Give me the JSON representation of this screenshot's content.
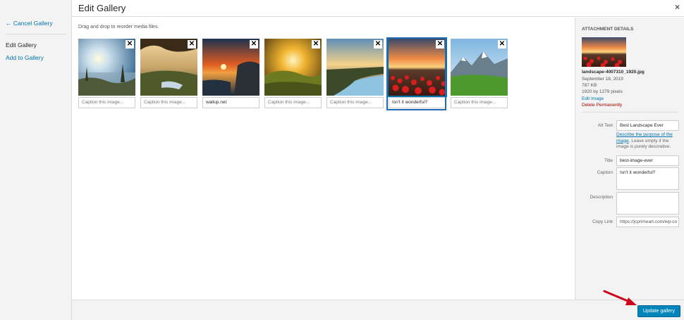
{
  "left_menu": {
    "cancel": "← Cancel Gallery",
    "items": [
      "Edit Gallery",
      "Add to Gallery"
    ]
  },
  "header": {
    "title": "Edit Gallery",
    "close": "×"
  },
  "main": {
    "instructions": "Drag and drop to reorder media files.",
    "thumbnails": [
      {
        "caption": "Caption this image...",
        "filled": false
      },
      {
        "caption": "Caption this image...",
        "filled": false
      },
      {
        "caption": "wallup.net",
        "filled": true
      },
      {
        "caption": "Caption this image...",
        "filled": false
      },
      {
        "caption": "Caption this image...",
        "filled": false
      },
      {
        "caption": "Isn't it wonderful?",
        "filled": true
      },
      {
        "caption": "Caption this image...",
        "filled": false
      }
    ],
    "remove_glyph": "✕",
    "selected_index": 5
  },
  "attachment": {
    "heading": "ATTACHMENT DETAILS",
    "filename": "landscape-4007310_1920.jpg",
    "date": "September 18, 2019",
    "size": "787 KB",
    "dimensions": "1920 by 1279 pixels",
    "edit_link": "Edit Image",
    "delete_link": "Delete Permanently",
    "alt_text_label": "Alt Text",
    "alt_text_value": "Best Landscape Ever",
    "alt_help_link": "Describe the purpose of the image",
    "alt_help_rest": ". Leave empty if the image is purely decorative.",
    "title_label": "Title",
    "title_value": "best-image-ever",
    "caption_label": "Caption",
    "caption_value": "Isn't it wonderful?",
    "description_label": "Description",
    "description_value": "",
    "copy_link_label": "Copy Link",
    "copy_link_value": "https://jcprimeart.com/wp-co"
  },
  "footer": {
    "update_button": "Update gallery"
  },
  "colors": {
    "accent": "#0085ba",
    "link": "#0073aa",
    "delete": "#aa0000",
    "arrow": "#d0021b"
  }
}
